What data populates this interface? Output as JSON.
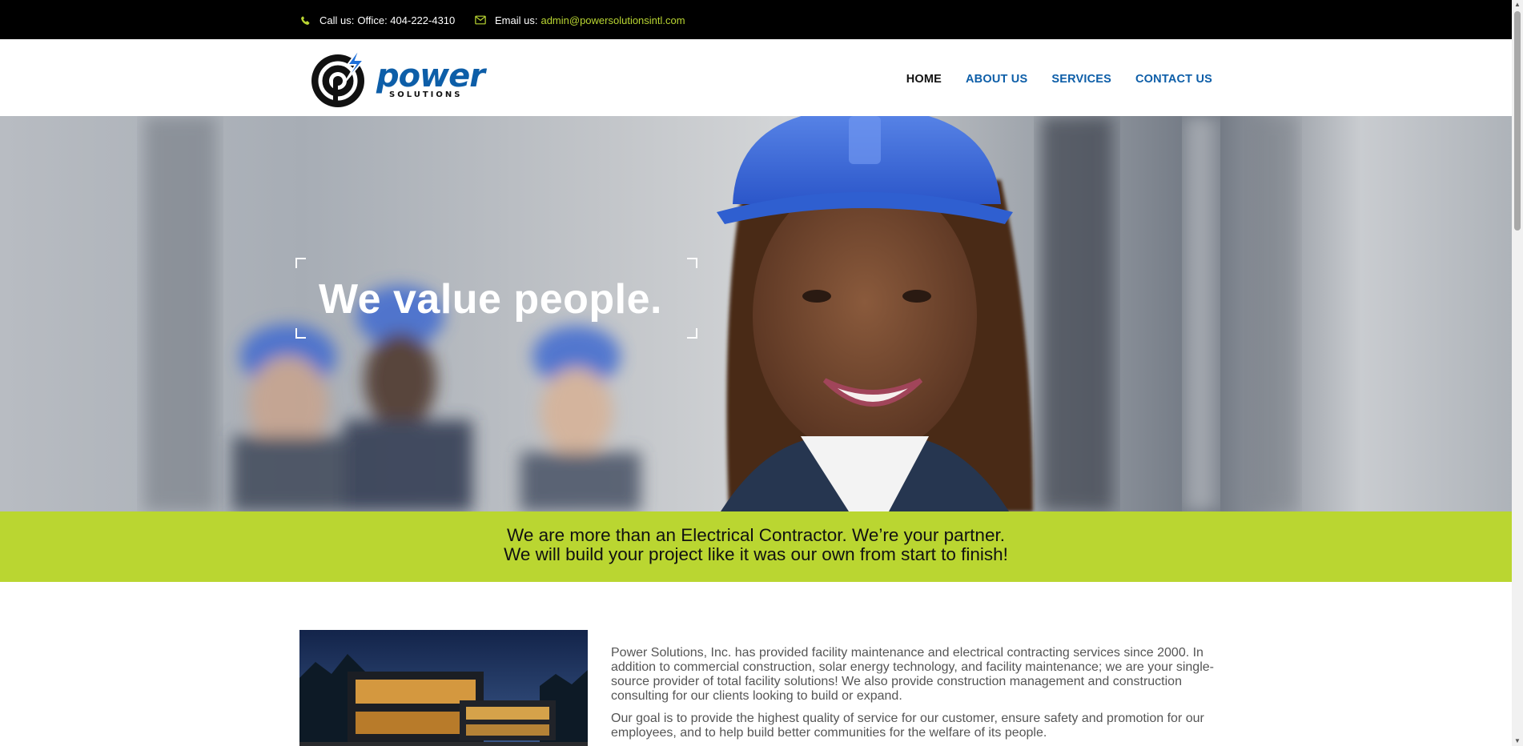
{
  "topbar": {
    "phone_label": "Call us:",
    "phone_value": "Office: 404-222-4310",
    "email_label": "Email us:",
    "email_value": "admin@powersolutionsintl.com",
    "accent_color": "#b9d532"
  },
  "header": {
    "logo_word": "power",
    "logo_sub": "SOLUTIONS",
    "brand_color": "#0d5ea8",
    "nav": [
      {
        "label": "HOME",
        "active": true
      },
      {
        "label": "ABOUT US",
        "active": false
      },
      {
        "label": "SERVICES",
        "active": false
      },
      {
        "label": "CONTACT US",
        "active": false
      }
    ]
  },
  "hero": {
    "title": "We value people."
  },
  "band": {
    "line1": "We are more than an Electrical Contractor. We’re your partner.",
    "line2": "We will build your project like it was our own from start to finish!",
    "color": "#bad631"
  },
  "content": {
    "paragraph1": "Power Solutions, Inc. has provided facility maintenance and electrical contracting services since 2000. In addition to commercial construction, solar energy technology, and facility maintenance; we are your single-source provider of total facility solutions! We also provide construction management and construction consulting for our clients looking to build or expand.",
    "paragraph2": "Our goal is to provide the highest quality of service for our customer, ensure safety and promotion for our employees, and to help build better communities for the welfare of its people."
  }
}
